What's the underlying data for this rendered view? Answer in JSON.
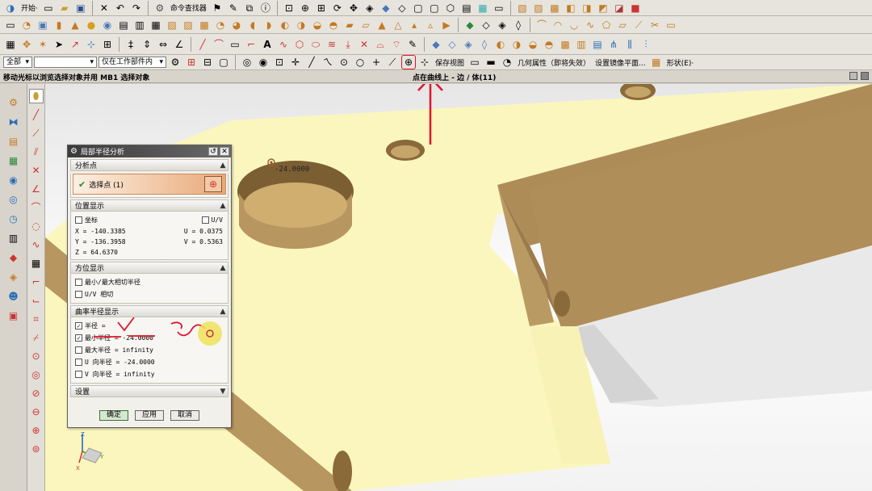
{
  "toolbar1": {
    "start_label": "开始·",
    "command_finder_label": "命令查找器"
  },
  "toolbar4": {
    "filter_value": "全部",
    "scope_value": "仅在工作部件内",
    "save_view_label": "保存视图",
    "geometry_label": "几何属性（即将失效）",
    "mirror_label": "设置镜像平面...",
    "shape_label": "形状(E)·"
  },
  "status": {
    "left": "移动光标以浏览选择对象并用 MB1 选择对象",
    "center": "点在曲线上 - 边 / 体(11)"
  },
  "viewport": {
    "point_label": "-24.0000"
  },
  "dialog": {
    "title": "局部半径分析",
    "sections": {
      "analysis_point": "分析点",
      "location": "位置显示",
      "orientation": "方位显示",
      "curvature": "曲率半径显示",
      "settings": "设置"
    },
    "select_point": "选择点 (1)",
    "location": {
      "coords_label": "坐标",
      "uv_label": "U/V",
      "x": "X = -140.3385",
      "y": "Y = -136.3958",
      "z": "Z = 64.6370",
      "u": "U = 0.0375",
      "v": "V = 0.5363"
    },
    "orientation": {
      "minmax": "最小/最大相切半径",
      "uv_tangent": "U/V 相切"
    },
    "curvature": {
      "radius": "半径 =",
      "min_radius": "最小半径 = -24.0000",
      "max_radius": "最大半径 = infinity",
      "u_radius": "U 向半径 = -24.0000",
      "v_radius": "V 向半径 = infinity"
    },
    "buttons": {
      "ok": "确定",
      "apply": "应用",
      "cancel": "取消"
    }
  },
  "colors": {
    "face_top": "#fbf6bd",
    "face_side": "#b8965f",
    "face_dark": "#8f6e3e",
    "title_bar": "#3b3b3b",
    "annotation_red": "#e0152b"
  }
}
